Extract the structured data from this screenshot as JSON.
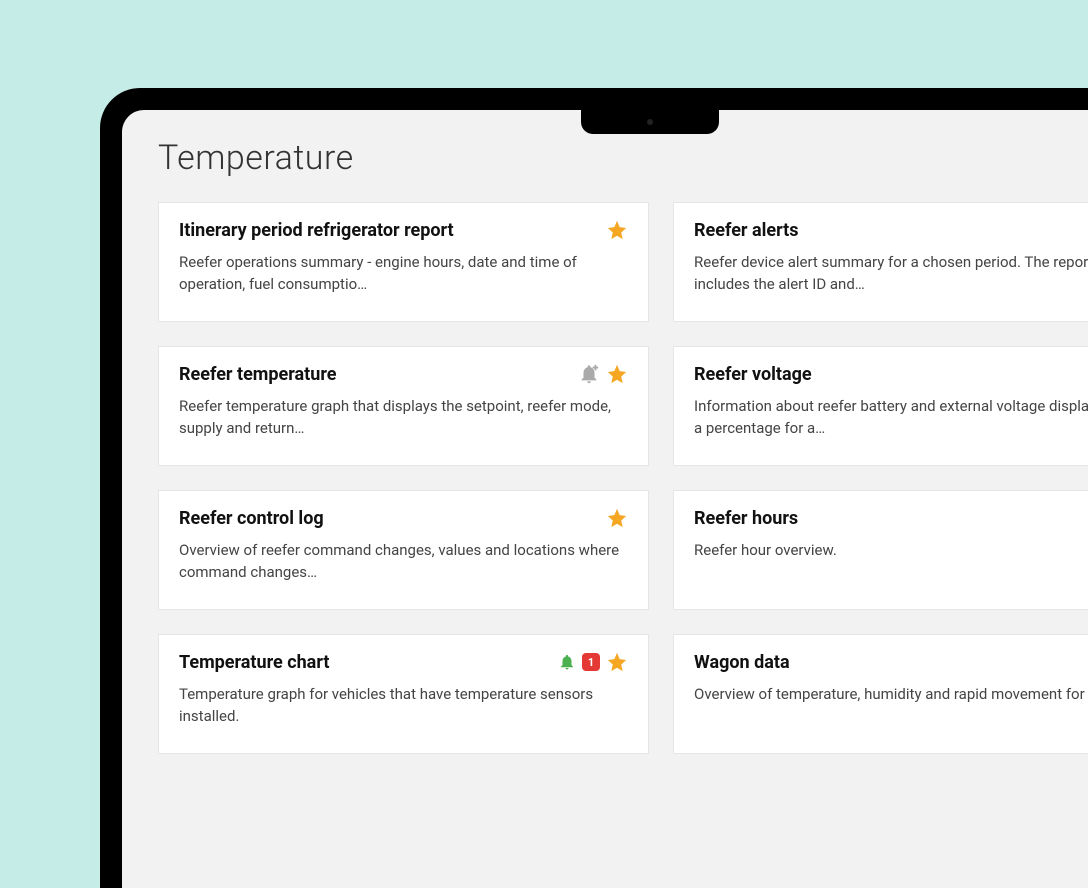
{
  "page_title": "Temperature",
  "cards": [
    {
      "title": "Itinerary period refrigerator report",
      "desc": "Reefer operations summary - engine hours, date and time of operation, fuel consumptio…",
      "star": true,
      "bell_add": false,
      "bell": false,
      "badge": null
    },
    {
      "title": "Reefer alerts",
      "desc": "Reefer device alert summary for a chosen period. The report includes the alert ID and…",
      "star": true,
      "bell_add": false,
      "bell": false,
      "badge": null
    },
    {
      "title": "Reefer temperature",
      "desc": "Reefer temperature graph that displays the setpoint, reefer mode, supply and return…",
      "star": true,
      "bell_add": true,
      "bell": false,
      "badge": null
    },
    {
      "title": "Reefer voltage",
      "desc": "Information about reefer battery and external voltage displayed as a percentage for a…",
      "star": true,
      "bell_add": false,
      "bell": false,
      "badge": null
    },
    {
      "title": "Reefer control log",
      "desc": "Overview of reefer command changes, values and locations where command changes…",
      "star": true,
      "bell_add": false,
      "bell": false,
      "badge": null
    },
    {
      "title": "Reefer hours",
      "desc": "Reefer hour overview.",
      "star": true,
      "bell_add": false,
      "bell": false,
      "badge": null
    },
    {
      "title": "Temperature chart",
      "desc": "Temperature graph for vehicles that have temperature sensors installed.",
      "star": true,
      "bell_add": false,
      "bell": true,
      "badge": "1"
    },
    {
      "title": "Wagon data",
      "desc": "Overview of temperature, humidity and rapid movement for trailers.",
      "star": true,
      "bell_add": false,
      "bell": false,
      "badge": null
    }
  ]
}
